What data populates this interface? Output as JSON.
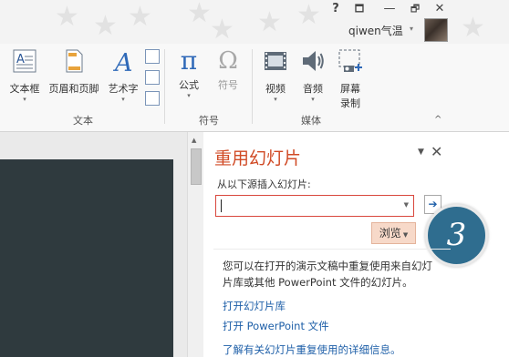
{
  "titlebar": {
    "help": "?",
    "ribbon_display": "🗖",
    "minimize": "—",
    "restore": "🗗",
    "close": "✕",
    "user_name": "qiwen气温",
    "user_caret": "▾"
  },
  "ribbon": {
    "groups": {
      "text": {
        "label": "文本",
        "textbox": "文本框",
        "header_footer": "页眉和页脚",
        "wordart": "艺术字"
      },
      "symbols": {
        "label": "符号",
        "equation": "公式",
        "equation_glyph": "π",
        "symbol": "符号",
        "symbol_glyph": "Ω"
      },
      "media": {
        "label": "媒体",
        "video": "视频",
        "audio": "音频",
        "screen_recording_line1": "屏幕",
        "screen_recording_line2": "录制"
      }
    },
    "caret": "▾",
    "collapse": "^"
  },
  "task_pane": {
    "title": "重用幻灯片",
    "menu": "▼",
    "close": "✕",
    "insert_from_label": "从以下源插入幻灯片:",
    "source_value": "",
    "combo_caret": "▼",
    "go_arrow": "➔",
    "browse": "浏览",
    "browse_caret": "▼",
    "description": "您可以在打开的演示文稿中重复使用来自幻灯片库或其他 PowerPoint 文件的幻灯片。",
    "link_slide_library": "打开幻灯片库",
    "link_powerpoint_file": "打开 PowerPoint 文件",
    "link_learn_more": "了解有关幻灯片重复使用的详细信息。"
  },
  "step_badge": "3",
  "colors": {
    "pane_title": "#d04a25",
    "link": "#1e5fa8",
    "combo_border": "#d9473d",
    "browse_bg": "#f7d9c9",
    "badge": "#2f6d8f",
    "slide_bg": "#2f3a3e"
  }
}
